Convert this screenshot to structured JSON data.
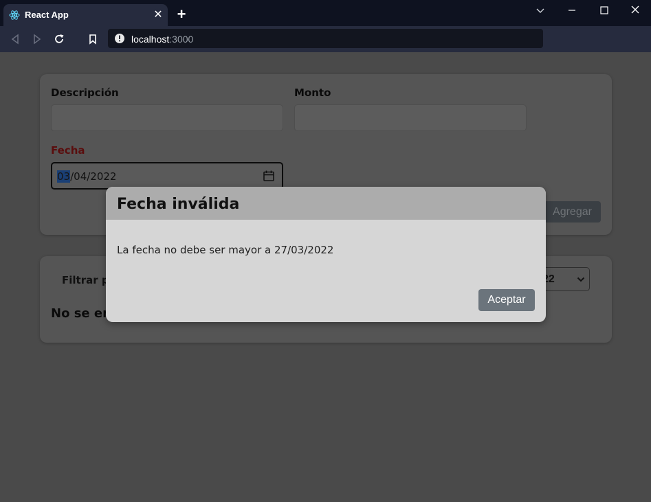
{
  "browser": {
    "tab_title": "React App",
    "url_host": "localhost",
    "url_port": ":3000"
  },
  "form": {
    "descripcion_label": "Descripción",
    "monto_label": "Monto",
    "fecha_label": "Fecha",
    "fecha_day": "03",
    "fecha_rest": "/04/2022",
    "agregar_label": "Agregar"
  },
  "filter": {
    "label": "Filtrar po",
    "select_value": "22",
    "no_results": "No se enc"
  },
  "modal": {
    "title": "Fecha inválida",
    "message": "La fecha no debe ser mayor a 27/03/2022",
    "accept_label": "Aceptar"
  },
  "colors": {
    "fecha_label": "#5a0d0d",
    "accept_button": "#6b747c",
    "date_selection": "#1a3f75"
  }
}
